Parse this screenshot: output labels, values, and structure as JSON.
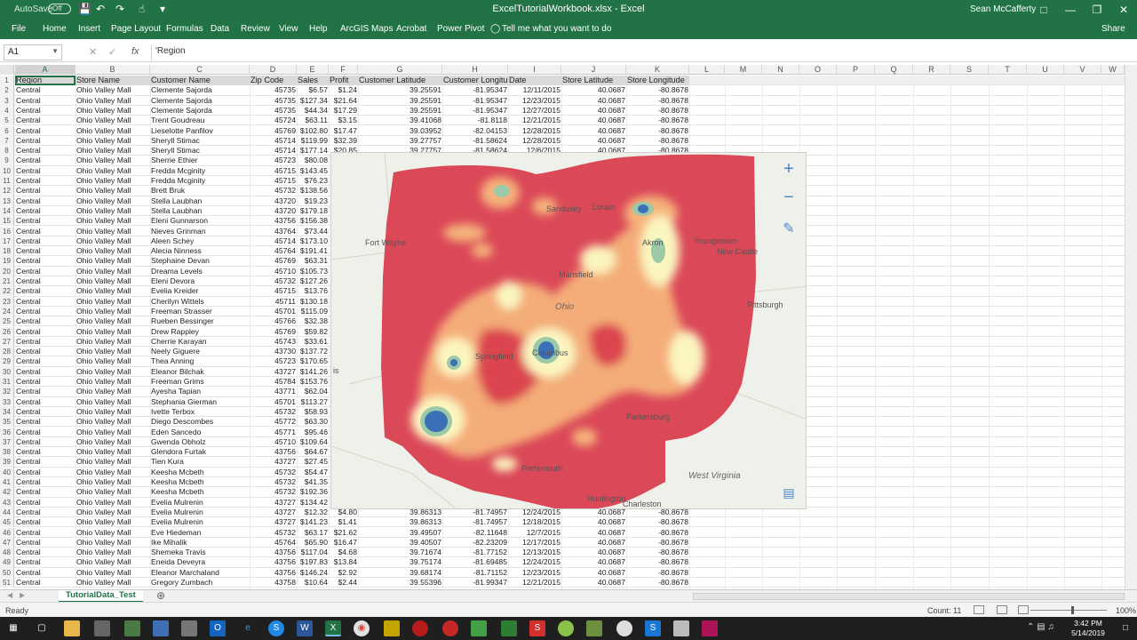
{
  "titlebar": {
    "autosave_label": "AutoSave",
    "autosave_state": "Off",
    "title": "ExcelTutorialWorkbook.xlsx - Excel",
    "user": "Sean McCafferty"
  },
  "ribbon": {
    "tabs": [
      "File",
      "Home",
      "Insert",
      "Page Layout",
      "Formulas",
      "Data",
      "Review",
      "View",
      "Help",
      "ArcGIS Maps",
      "Acrobat",
      "Power Pivot"
    ],
    "tell_me": "Tell me what you want to do",
    "share": "Share"
  },
  "formula_bar": {
    "name_box": "A1",
    "fx": "fx",
    "content": "'Region"
  },
  "columns": [
    "A",
    "B",
    "C",
    "D",
    "E",
    "F",
    "G",
    "H",
    "I",
    "J",
    "K",
    "L",
    "M",
    "N",
    "O",
    "P",
    "Q",
    "R",
    "S",
    "T",
    "U",
    "V",
    "W"
  ],
  "headers": [
    "Region",
    "Store Name",
    "Customer Name",
    "Zip Code",
    "Sales",
    "Profit",
    "Customer Latitude",
    "Customer Longitude",
    "Date",
    "Store Latitude",
    "Store Longitude"
  ],
  "rows": [
    [
      "Central",
      "Ohio Valley Mall",
      "Clemente Sajorda",
      "45735",
      "$6.57",
      "$1.24",
      "39.25591",
      "-81.95347",
      "12/11/2015",
      "40.0687",
      "-80.8678"
    ],
    [
      "Central",
      "Ohio Valley Mall",
      "Clemente Sajorda",
      "45735",
      "$127.34",
      "$21.64",
      "39.25591",
      "-81.95347",
      "12/23/2015",
      "40.0687",
      "-80.8678"
    ],
    [
      "Central",
      "Ohio Valley Mall",
      "Clemente Sajorda",
      "45735",
      "$44.34",
      "$17.29",
      "39.25591",
      "-81.95347",
      "12/27/2015",
      "40.0687",
      "-80.8678"
    ],
    [
      "Central",
      "Ohio Valley Mall",
      "Trent Goudreau",
      "45724",
      "$63.11",
      "$3.15",
      "39.41068",
      "-81.8118",
      "12/21/2015",
      "40.0687",
      "-80.8678"
    ],
    [
      "Central",
      "Ohio Valley Mall",
      "Lieselotte Panfilov",
      "45769",
      "$102.80",
      "$17.47",
      "39.03952",
      "-82.04153",
      "12/28/2015",
      "40.0687",
      "-80.8678"
    ],
    [
      "Central",
      "Ohio Valley Mall",
      "Sheryll Stimac",
      "45714",
      "$119.99",
      "$32.39",
      "39.27757",
      "-81.58624",
      "12/28/2015",
      "40.0687",
      "-80.8678"
    ],
    [
      "Central",
      "Ohio Valley Mall",
      "Sheryll Stimac",
      "45714",
      "$177.14",
      "$20.85",
      "39.27757",
      "-81.58624",
      "12/6/2015",
      "40.0687",
      "-80.8678"
    ],
    [
      "Central",
      "Ohio Valley Mall",
      "Sherrie Ethier",
      "45723",
      "$80.08",
      "",
      "",
      "",
      "",
      "",
      ""
    ],
    [
      "Central",
      "Ohio Valley Mall",
      "Fredda Mcginity",
      "45715",
      "$143.45",
      "",
      "",
      "",
      "",
      "",
      ""
    ],
    [
      "Central",
      "Ohio Valley Mall",
      "Fredda Mcginity",
      "45715",
      "$76.23",
      "",
      "",
      "",
      "",
      "",
      ""
    ],
    [
      "Central",
      "Ohio Valley Mall",
      "Brett Bruk",
      "45732",
      "$138.56",
      "",
      "",
      "",
      "",
      "",
      ""
    ],
    [
      "Central",
      "Ohio Valley Mall",
      "Stella Laubhan",
      "43720",
      "$19.23",
      "",
      "",
      "",
      "",
      "",
      ""
    ],
    [
      "Central",
      "Ohio Valley Mall",
      "Stella Laubhan",
      "43720",
      "$179.18",
      "",
      "",
      "",
      "",
      "",
      ""
    ],
    [
      "Central",
      "Ohio Valley Mall",
      "Eleni Gunnarson",
      "43756",
      "$156.38",
      "",
      "",
      "",
      "",
      "",
      ""
    ],
    [
      "Central",
      "Ohio Valley Mall",
      "Nieves Grinman",
      "43764",
      "$73.44",
      "",
      "",
      "",
      "",
      "",
      ""
    ],
    [
      "Central",
      "Ohio Valley Mall",
      "Aleen Schey",
      "45714",
      "$173.10",
      "",
      "",
      "",
      "",
      "",
      ""
    ],
    [
      "Central",
      "Ohio Valley Mall",
      "Alecia Ninness",
      "45764",
      "$191.41",
      "",
      "",
      "",
      "",
      "",
      ""
    ],
    [
      "Central",
      "Ohio Valley Mall",
      "Stephaine Devan",
      "45769",
      "$63.31",
      "",
      "",
      "",
      "",
      "",
      ""
    ],
    [
      "Central",
      "Ohio Valley Mall",
      "Dreama Levels",
      "45710",
      "$105.73",
      "",
      "",
      "",
      "",
      "",
      ""
    ],
    [
      "Central",
      "Ohio Valley Mall",
      "Eleni Devora",
      "45732",
      "$127.26",
      "",
      "",
      "",
      "",
      "",
      ""
    ],
    [
      "Central",
      "Ohio Valley Mall",
      "Evelia Kreider",
      "45715",
      "$13.76",
      "",
      "",
      "",
      "",
      "",
      ""
    ],
    [
      "Central",
      "Ohio Valley Mall",
      "Cherilyn Wittels",
      "45711",
      "$130.18",
      "",
      "",
      "",
      "",
      "",
      ""
    ],
    [
      "Central",
      "Ohio Valley Mall",
      "Freeman Strasser",
      "45701",
      "$115.09",
      "",
      "",
      "",
      "",
      "",
      ""
    ],
    [
      "Central",
      "Ohio Valley Mall",
      "Rueben Bessinger",
      "45766",
      "$32.38",
      "",
      "",
      "",
      "",
      "",
      ""
    ],
    [
      "Central",
      "Ohio Valley Mall",
      "Drew Rappley",
      "45769",
      "$59.82",
      "",
      "",
      "",
      "",
      "",
      ""
    ],
    [
      "Central",
      "Ohio Valley Mall",
      "Cherrie Karayan",
      "45743",
      "$33.61",
      "",
      "",
      "",
      "",
      "",
      ""
    ],
    [
      "Central",
      "Ohio Valley Mall",
      "Neely Giguere",
      "43730",
      "$137.72",
      "",
      "",
      "",
      "",
      "",
      ""
    ],
    [
      "Central",
      "Ohio Valley Mall",
      "Thea Anning",
      "45723",
      "$170.65",
      "",
      "",
      "",
      "",
      "",
      ""
    ],
    [
      "Central",
      "Ohio Valley Mall",
      "Eleanor Bilchak",
      "43727",
      "$141.26",
      "",
      "",
      "",
      "",
      "",
      ""
    ],
    [
      "Central",
      "Ohio Valley Mall",
      "Freeman Grims",
      "45784",
      "$153.76",
      "",
      "",
      "",
      "",
      "",
      ""
    ],
    [
      "Central",
      "Ohio Valley Mall",
      "Ayesha Tapian",
      "43771",
      "$62.04",
      "",
      "",
      "",
      "",
      "",
      ""
    ],
    [
      "Central",
      "Ohio Valley Mall",
      "Stephania Gierman",
      "45701",
      "$113.27",
      "",
      "",
      "",
      "",
      "",
      ""
    ],
    [
      "Central",
      "Ohio Valley Mall",
      "Ivette Terbox",
      "45732",
      "$58.93",
      "",
      "",
      "",
      "",
      "",
      ""
    ],
    [
      "Central",
      "Ohio Valley Mall",
      "Diego Descombes",
      "45772",
      "$63.30",
      "",
      "",
      "",
      "",
      "",
      ""
    ],
    [
      "Central",
      "Ohio Valley Mall",
      "Eden Sancedo",
      "45771",
      "$95.46",
      "",
      "",
      "",
      "",
      "",
      ""
    ],
    [
      "Central",
      "Ohio Valley Mall",
      "Gwenda Obholz",
      "45710",
      "$109.64",
      "",
      "",
      "",
      "",
      "",
      ""
    ],
    [
      "Central",
      "Ohio Valley Mall",
      "Glendora Furtak",
      "43756",
      "$64.67",
      "",
      "",
      "",
      "",
      "",
      ""
    ],
    [
      "Central",
      "Ohio Valley Mall",
      "Tien Kura",
      "43727",
      "$27.45",
      "",
      "",
      "",
      "",
      "",
      ""
    ],
    [
      "Central",
      "Ohio Valley Mall",
      "Keesha Mcbeth",
      "45732",
      "$54.47",
      "",
      "",
      "",
      "",
      "",
      ""
    ],
    [
      "Central",
      "Ohio Valley Mall",
      "Keesha Mcbeth",
      "45732",
      "$41.35",
      "",
      "",
      "",
      "",
      "",
      ""
    ],
    [
      "Central",
      "Ohio Valley Mall",
      "Keesha Mcbeth",
      "45732",
      "$192.36",
      "",
      "",
      "",
      "",
      "",
      ""
    ],
    [
      "Central",
      "Ohio Valley Mall",
      "Evelia Mulrenin",
      "43727",
      "$134.42",
      "",
      "",
      "",
      "",
      "",
      ""
    ],
    [
      "Central",
      "Ohio Valley Mall",
      "Evelia Mulrenin",
      "43727",
      "$12.32",
      "$4.80",
      "39.86313",
      "-81.74957",
      "12/24/2015",
      "40.0687",
      "-80.8678"
    ],
    [
      "Central",
      "Ohio Valley Mall",
      "Evelia Mulrenin",
      "43727",
      "$141.23",
      "$1.41",
      "39.86313",
      "-81.74957",
      "12/18/2015",
      "40.0687",
      "-80.8678"
    ],
    [
      "Central",
      "Ohio Valley Mall",
      "Eve Hiedeman",
      "45732",
      "$63.17",
      "$21.62",
      "39.49507",
      "-82.11648",
      "12/7/2015",
      "40.0687",
      "-80.8678"
    ],
    [
      "Central",
      "Ohio Valley Mall",
      "Ike Mihalik",
      "45764",
      "$65.90",
      "$16.47",
      "39.40507",
      "-82.23209",
      "12/17/2015",
      "40.0687",
      "-80.8678"
    ],
    [
      "Central",
      "Ohio Valley Mall",
      "Shemeka Travis",
      "43756",
      "$117.04",
      "$4.68",
      "39.71674",
      "-81.77152",
      "12/13/2015",
      "40.0687",
      "-80.8678"
    ],
    [
      "Central",
      "Ohio Valley Mall",
      "Eneida Deveyra",
      "43756",
      "$197.83",
      "$13.84",
      "39.75174",
      "-81.69485",
      "12/24/2015",
      "40.0687",
      "-80.8678"
    ],
    [
      "Central",
      "Ohio Valley Mall",
      "Eleanor Marchaland",
      "43756",
      "$146.24",
      "$2.92",
      "39.68174",
      "-81.71152",
      "12/23/2015",
      "40.0687",
      "-80.8678"
    ],
    [
      "Central",
      "Ohio Valley Mall",
      "Gregory Zumbach",
      "43758",
      "$10.64",
      "$2.44",
      "39.55396",
      "-81.99347",
      "12/21/2015",
      "40.0687",
      "-80.8678"
    ]
  ],
  "map": {
    "labels": [
      "Fort Wayne",
      "Sandusky",
      "Lorain",
      "Akron",
      "Youngstown",
      "New Castle",
      "Mansfield",
      "Ohio",
      "Pittsburgh",
      "Springfield",
      "Columbus",
      "Parkersburg",
      "Portsmouth",
      "Huntington",
      "Charleston",
      "West Virginia",
      "is"
    ],
    "zoom_in": "+",
    "zoom_out": "−",
    "colors": {
      "low": "#d93a4b",
      "mid": "#f5b27a",
      "high": "#fbf5c0",
      "peak": "#3b6fb6"
    }
  },
  "sheet": {
    "tab": "TutorialData_Test"
  },
  "status": {
    "ready": "Ready",
    "count": "Count: 11",
    "zoom": "100%"
  },
  "clock": {
    "time": "3:42 PM",
    "date": "5/14/2019"
  }
}
